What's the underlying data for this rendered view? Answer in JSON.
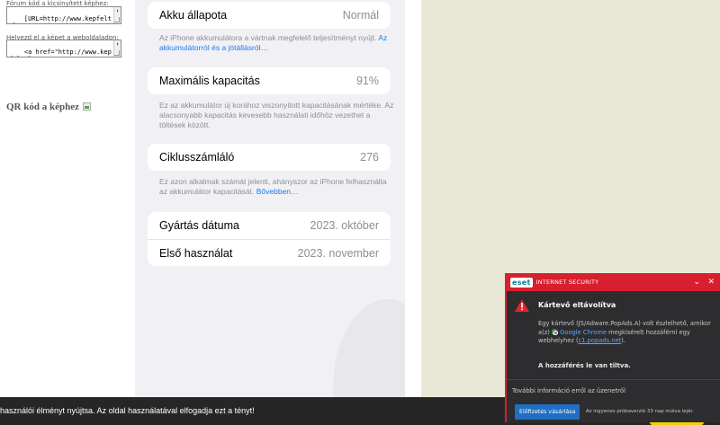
{
  "left": {
    "forum_label": "Fórum kód a kicsinyített képhez:",
    "forum_code": "[URL=http://www.kepfeltoltes.eu/view.php?",
    "embed_label": "Helyezd el a képet a weboldaladon:",
    "embed_code": "<a href=\"http://www.kepfeltol",
    "qr_heading": "QR kód a képhez"
  },
  "battery": {
    "status_title": "Akku állapota",
    "status_value": "Normál",
    "status_desc": "Az iPhone akkumulátora a vártnak megfelelő teljesítményt nyújt.",
    "status_link": "Az akkumulátorról és a jótállásról…",
    "capacity_title": "Maximális kapacitás",
    "capacity_value": "91%",
    "capacity_desc": "Ez az akkumulátor új korához viszonyított kapacitásának mértéke. Az alacsonyabb kapacitás kevesebb használati időhöz vezethet a töltések között.",
    "cycle_title": "Ciklusszámláló",
    "cycle_value": "276",
    "cycle_desc": "Ez azon alkalmak számát jelenti, ahányszor az iPhone felhasználta az akkumulátor kapacitását.",
    "cycle_link": "Bővebben…",
    "manufactured_title": "Gyártás dátuma",
    "manufactured_value": "2023. október",
    "first_use_title": "Első használat",
    "first_use_value": "2023. november"
  },
  "cookie": {
    "text": "használói élményt nyújtsa. Az oldal használatával elfogadja ezt a tényt!"
  },
  "eset": {
    "logo": "eset",
    "product": "INTERNET SECURITY",
    "title": "Kártevő eltávolítva",
    "body_1": "Egy kártevő (JS/Adware.PopAds.A) volt észlelhető, amikor a(z) ",
    "browser": "Google Chrome",
    "body_2": " megkísérelt hozzáférni egy webhelyhez (",
    "site": "c1.popads.net",
    "body_3": ").",
    "denied": "A hozzáférés le van tiltva.",
    "more_info": "További információ erről az üzenetről",
    "subscribe_button": "Előfizetés vásárlása",
    "trial_text": "Az ingyenes próbaverzió 33 nap múlva lejár.",
    "colors": {
      "header": "#d71f2f",
      "panel": "#2d2d2f",
      "button": "#1f6fc4"
    },
    "icons": {
      "warning": "warning-icon",
      "chevron": "chevron-down-icon",
      "close": "close-icon"
    }
  }
}
